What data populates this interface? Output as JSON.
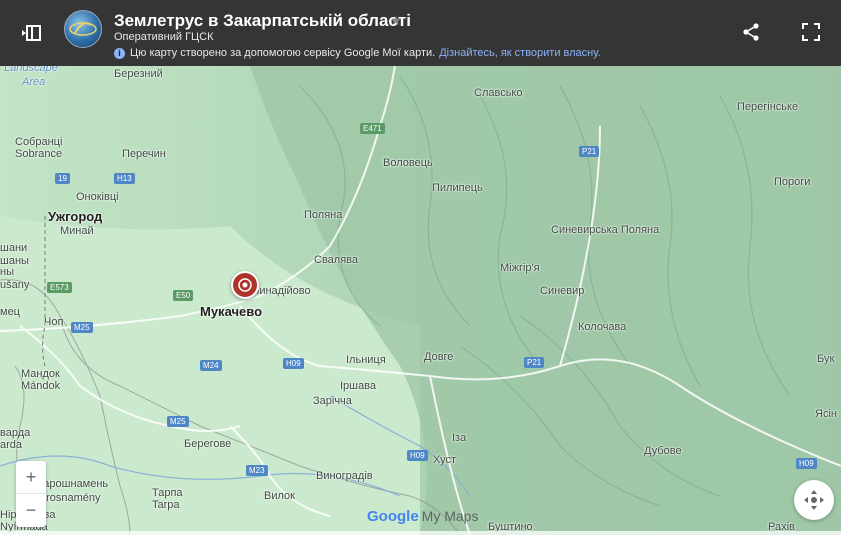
{
  "header": {
    "title": "Землетрус в Закарпатській області",
    "subtitle": "Оперативний ГЦСК",
    "notice_text": "Цю карту створено за допомогою сервісу Google Мої карти.",
    "notice_link": "Дізнайтесь, як створити власну."
  },
  "map": {
    "labels": {
      "landscape": "Landscape",
      "area": "Area",
      "bereznyi": "Березний",
      "sobrantsi": "Собранці",
      "sobrance": "Sobrance",
      "perechyn": "Перечин",
      "onokivtsi": "Оноківці",
      "uzhhorod": "Ужгород",
      "minai": "Минай",
      "shani": "шани",
      "shany": "шаны",
      "ny": "ны",
      "usany": "ušany",
      "mets": "мец",
      "chop": "Чоп",
      "mandok": "Мандок",
      "mandok_lat": "Mándok",
      "varda": "варда",
      "arda": "arda",
      "vasharoshnamen": "Вашарошнамень",
      "vasarosnameny": "Vásárosnamény",
      "niredhaza": "Ніредьгаза",
      "nyirmada": "Nyírmada",
      "slavsko": "Славсько",
      "volovets": "Воловець",
      "pylypets": "Пилипець",
      "polyana": "Поляна",
      "svalyava": "Свалява",
      "chynadiyovo": "Чинадійово",
      "mukachevo": "Мукачево",
      "ilnytsia": "Ільниця",
      "dovhe": "Довге",
      "irshava": "Іршава",
      "zarichchia": "Зарічча",
      "berehove": "Берегове",
      "tarpa": "Тарпа",
      "tarpa_lat": "Tarpa",
      "vylok": "Вилок",
      "vynohradiv": "Виноградів",
      "khust": "Хуст",
      "iza": "Іза",
      "bushtyno": "Буштино",
      "mizhhiria": "Міжгір'я",
      "synevyr": "Синевир",
      "synevyrska_polyana": "Синевирська Поляна",
      "kolochava": "Колочава",
      "dubove": "Дубове",
      "perehinske": "Перегінське",
      "porohy": "Пороги",
      "buk": "Бук",
      "yasin": "Ясін",
      "rakhiv": "Рахів"
    },
    "shields": {
      "e471": "E471",
      "p21_top": "P21",
      "p21_mid": "P21",
      "h13": "H13",
      "r19": "19",
      "e573": "E573",
      "e50": "E50",
      "m25_a": "M25",
      "m25_b": "M25",
      "m24": "M24",
      "h09_a": "H09",
      "h09_b": "H09",
      "h09_c": "H09",
      "m23": "M23"
    },
    "zoom_in": "+",
    "zoom_out": "−",
    "google_logo": "Google",
    "mymaps": "My Maps",
    "marker_color": "#b0332b"
  }
}
